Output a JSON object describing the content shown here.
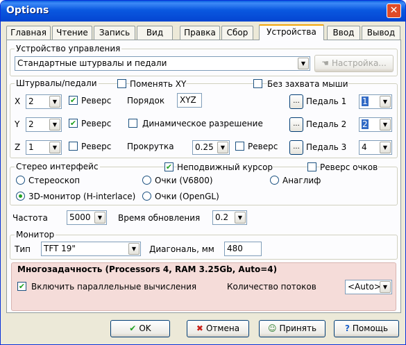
{
  "window": {
    "title": "Options",
    "close_glyph": "✕"
  },
  "tabs": [
    "Главная",
    "Чтение",
    "Запись",
    "Вид",
    "Правка",
    "Сбор",
    "Устройства",
    "Ввод",
    "Вывод"
  ],
  "active_tab": "Устройства",
  "control_device": {
    "legend": "Устройство управления",
    "device_value": "Стандартные штурвалы и педали",
    "settings_button": "Настройка..."
  },
  "axes": {
    "legend": "Штурвалы/педали",
    "swap_xy": "Поменять XY",
    "no_mouse_capture": "Без захвата мыши",
    "x_label": "X",
    "x_value": "2",
    "x_reverse": "Реверс",
    "x_reverse_checked": true,
    "order_label": "Порядок",
    "order_value": "XYZ",
    "pedal1_label": "Педаль 1",
    "pedal1_value": "1",
    "y_label": "Y",
    "y_value": "2",
    "y_reverse": "Реверс",
    "y_reverse_checked": true,
    "dynamic_res": "Динамическое разрешение",
    "pedal2_label": "Педаль 2",
    "pedal2_value": "2",
    "z_label": "Z",
    "z_value": "1",
    "z_reverse": "Реверс",
    "z_reverse_checked": false,
    "scroll_label": "Прокрутка",
    "scroll_value": "0.25",
    "scroll_reverse": "Реверс",
    "pedal3_label": "Педаль 3",
    "pedal3_value": "4",
    "dots": "..."
  },
  "stereo": {
    "legend": "Стерео интерфейс",
    "fixed_cursor": "Неподвижный курсор",
    "fixed_cursor_checked": true,
    "reverse_glasses": "Реверс очков",
    "options": [
      "Стереоскоп",
      "Очки (V6800)",
      "Анаглиф",
      "3D-монитор (H-interlace)",
      "Очки (OpenGL)"
    ],
    "selected": "3D-монитор (H-interlace)"
  },
  "frequency": {
    "label": "Частота",
    "value": "5000",
    "refresh_label": "Время обновления",
    "refresh_value": "0.2"
  },
  "monitor": {
    "legend": "Монитор",
    "type_label": "Тип",
    "type_value": "TFT 19\"",
    "diag_label": "Диагональ, мм",
    "diag_value": "480"
  },
  "multitask": {
    "header": "Многозадачность (Processors 4, RAM 3.25Gb, Auto=4)",
    "parallel": "Включить параллельные вычисления",
    "parallel_checked": true,
    "threads_label": "Количество потоков",
    "threads_value": "<Auto>"
  },
  "buttons": {
    "ok": "OK",
    "cancel": "Отмена",
    "apply": "Принять",
    "help": "Помощь"
  },
  "glyphs": {
    "check": "✔",
    "arrow": "▼"
  },
  "colors": {
    "title_bar": "#0a58e0",
    "active_tab_accent": "#f2a60a",
    "multitask_bg": "#f5dcd9",
    "check_green": "#21a121",
    "selection": "#316ac5"
  }
}
